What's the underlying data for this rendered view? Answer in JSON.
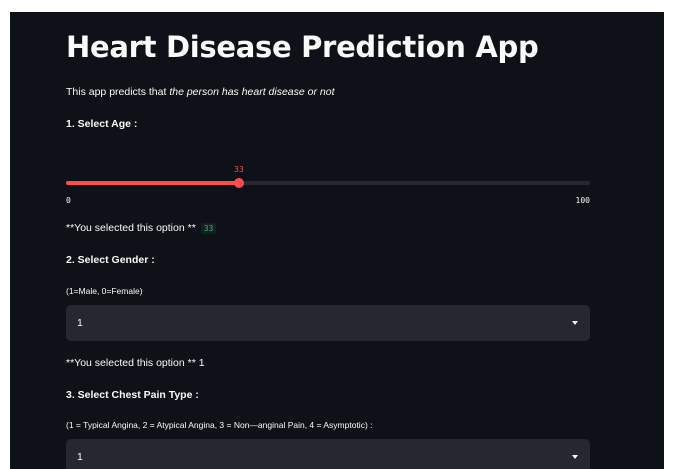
{
  "app": {
    "title": "Heart Disease Prediction App",
    "intro_prefix": "This app predicts that ",
    "intro_emphasis": "the person has heart disease or not"
  },
  "age": {
    "heading": "1. Select Age :",
    "slider_value": "33",
    "slider_value_num": 33,
    "min": "0",
    "max": "100",
    "min_num": 0,
    "max_num": 100,
    "selected_prefix": "**You selected this option **",
    "selected_value": "33"
  },
  "gender": {
    "heading": "2. Select Gender :",
    "hint": "(1=Male, 0=Female)",
    "select_value": "1",
    "selected_text": "**You selected this option ** 1"
  },
  "chest_pain": {
    "heading": "3. Select Chest Pain Type :",
    "hint": "(1 = Typical Angina, 2 = Atypical Angina, 3 = Non—anginal Pain, 4 = Asymptotic) :",
    "select_value": "1"
  },
  "colors": {
    "background": "#0e1117",
    "accent": "#ff4b4b",
    "widget_bg": "#262730",
    "code_green": "#21c354"
  },
  "icons": {
    "select_arrow": "chevron-down-icon"
  }
}
